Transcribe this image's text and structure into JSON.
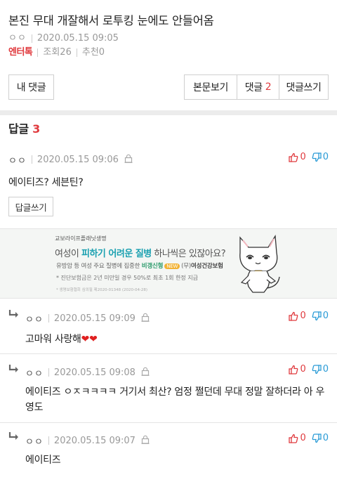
{
  "post": {
    "title": "본진 무대 개잘해서 로투킹 눈에도 안들어옴",
    "author": "ㅇㅇ",
    "datetime": "2020.05.15 09:05",
    "category": "엔터톡",
    "views_label": "조회26",
    "likes_label": "추천0"
  },
  "buttons": {
    "my_comments": "내 댓글",
    "view_post": "본문보기",
    "comments_label": "댓글",
    "comments_count": "2",
    "write_comment": "댓글쓰기"
  },
  "replies_header": {
    "label": "답글",
    "count": "3"
  },
  "main_comment": {
    "author": "ㅇㅇ",
    "datetime": "2020.05.15 09:06",
    "text": "에이티즈? 세븐틴?",
    "up": "0",
    "down": "0",
    "reply_button": "답글쓰기"
  },
  "ad": {
    "brand": "교보라이프플래닛생명",
    "headline_pre": "여성이 ",
    "headline_highlight": "피하기 어려운 질병",
    "headline_post": " 하나씩은 있잖아요?",
    "line2_pre": "유방암 등 여성 주요 질병에 집중한 ",
    "line2_product": "비갱신형",
    "line2_tag": "NEW",
    "line2_post": "(무)",
    "line2_name": "여성건강보험",
    "line3": "* 진단보험금은 2년 미만일 경우 50%로 최초 1회 한정 지급",
    "line4": "* 생명보험협회 심의필 제2020-01348 (2020-04-28)"
  },
  "sub_comments": [
    {
      "author": "ㅇㅇ",
      "datetime": "2020.05.15 09:09",
      "text": "고마워 사랑해❤❤",
      "up": "0",
      "down": "0"
    },
    {
      "author": "ㅇㅇ",
      "datetime": "2020.05.15 09:08",
      "text": "에이티즈 ㅇㅈㅋㅋㅋㅋ 거기서 최산? 엄정 쩔던데 무대 정말 잘하더라 아 우영도",
      "up": "0",
      "down": "0"
    },
    {
      "author": "ㅇㅇ",
      "datetime": "2020.05.15 09:07",
      "text": "에이티즈",
      "up": "0",
      "down": "0"
    }
  ],
  "colors": {
    "accent_red": "#e03a3e",
    "down_blue": "#2a9bd6",
    "ad_teal": "#1aa0b0"
  }
}
